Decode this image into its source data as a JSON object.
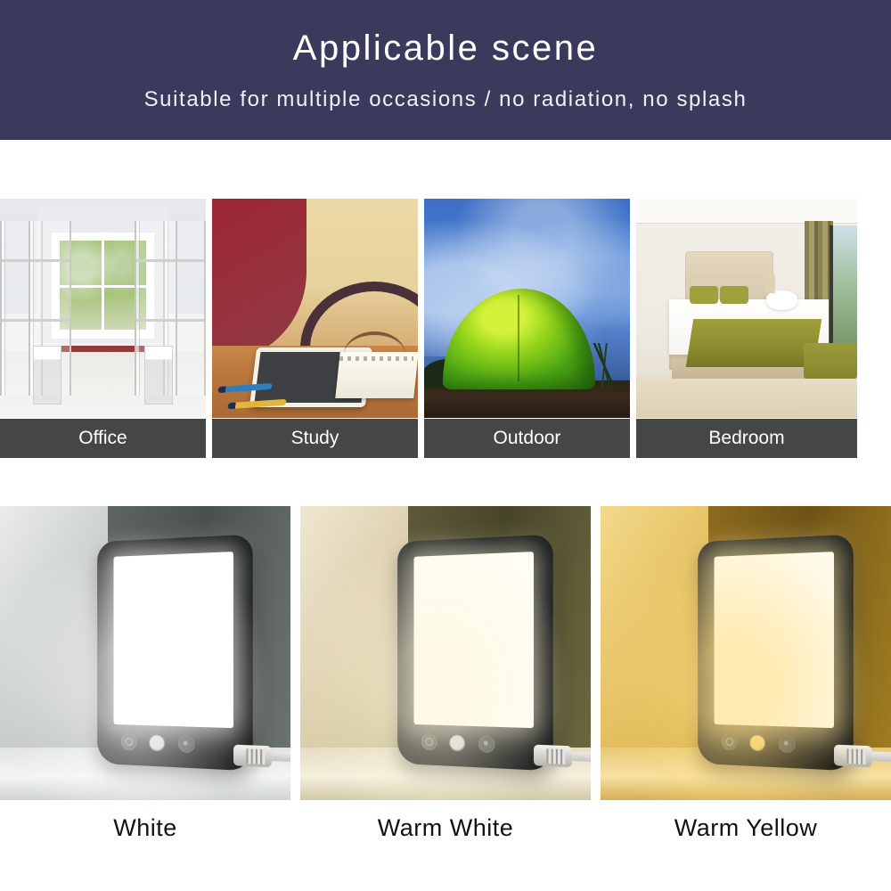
{
  "banner": {
    "title": "Applicable scene",
    "subtitle": "Suitable for multiple occasions / no radiation, no splash",
    "background_color": "#3a3a5c",
    "text_color": "#ffffff"
  },
  "scenes": {
    "label_bar_color": "#464646",
    "label_text_color": "#ffffff",
    "items": [
      {
        "label": "Office",
        "scene_name": "dorm-office-room-with-window"
      },
      {
        "label": "Study",
        "scene_name": "study-desk-tablet-notebook-glasses"
      },
      {
        "label": "Outdoor",
        "scene_name": "green-camping-tent-under-blue-sky"
      },
      {
        "label": "Bedroom",
        "scene_name": "hotel-bedroom-with-olive-bed-runner"
      }
    ]
  },
  "variants": {
    "caption_text_color": "#121212",
    "items": [
      {
        "label": "White",
        "tint_hex": "#ffffff",
        "room_accent": "#aab1ad",
        "product_name": "light-therapy-lamp"
      },
      {
        "label": "Warm White",
        "tint_hex": "#fffdf4",
        "room_accent": "#ddd0ae",
        "product_name": "light-therapy-lamp"
      },
      {
        "label": "Warm Yellow",
        "tint_hex": "#fffbea",
        "room_accent": "#e5c163",
        "product_name": "light-therapy-lamp"
      }
    ]
  },
  "product_controls": {
    "button_count": 3,
    "buttons": [
      {
        "name": "power-button"
      },
      {
        "name": "brightness-button"
      },
      {
        "name": "color-mode-button"
      }
    ],
    "cable": "usb-power-cable"
  }
}
